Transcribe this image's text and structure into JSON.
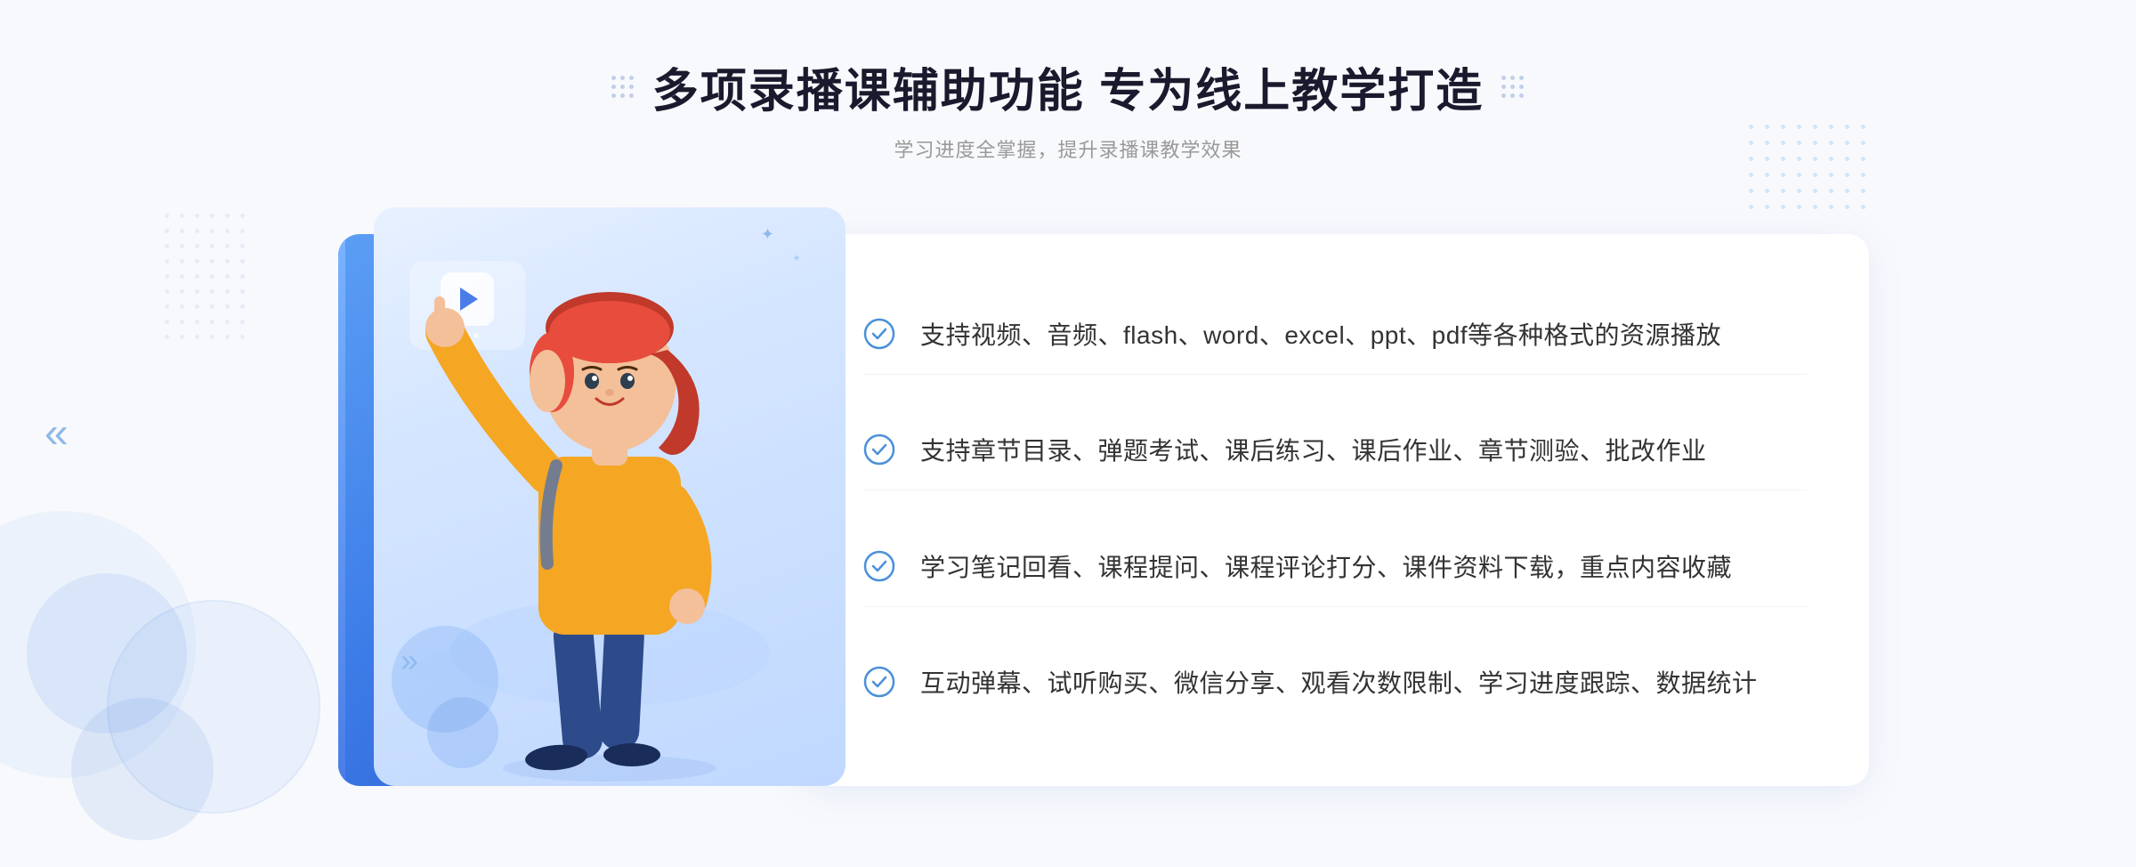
{
  "page": {
    "background_color": "#f5f8ff"
  },
  "header": {
    "title": "多项录播课辅助功能 专为线上教学打造",
    "subtitle": "学习进度全掌握，提升录播课教学效果",
    "decoration_left": "dots",
    "decoration_right": "dots"
  },
  "features": [
    {
      "id": 1,
      "text": "支持视频、音频、flash、word、excel、ppt、pdf等各种格式的资源播放"
    },
    {
      "id": 2,
      "text": "支持章节目录、弹题考试、课后练习、课后作业、章节测验、批改作业"
    },
    {
      "id": 3,
      "text": "学习笔记回看、课程提问、课程评论打分、课件资料下载，重点内容收藏"
    },
    {
      "id": 4,
      "text": "互动弹幕、试听购买、微信分享、观看次数限制、学习进度跟踪、数据统计"
    }
  ],
  "illustration": {
    "play_icon": "▶",
    "sparkle_1": "✦",
    "sparkle_2": "✦"
  },
  "navigation": {
    "left_arrow": "«"
  }
}
